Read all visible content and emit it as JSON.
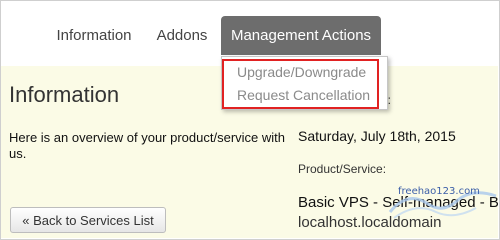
{
  "tabs": [
    {
      "label": "Information"
    },
    {
      "label": "Addons"
    },
    {
      "label": "Management Actions",
      "active": true
    }
  ],
  "dropdown": {
    "items": [
      {
        "label": "Upgrade/Downgrade"
      },
      {
        "label": "Request Cancellation"
      }
    ]
  },
  "main": {
    "title": "Information",
    "overview": "Here is an overview of your product/service with us.",
    "label_cut": "e:",
    "registration_date": "Saturday, July 18th, 2015",
    "product_label": "Product/Service:",
    "product_value": "Basic VPS - Self-managed - Bar",
    "hostname": "localhost.localdomain"
  },
  "back_button": {
    "label": "« Back to Services List"
  },
  "watermark": {
    "text": "freehao123.com"
  },
  "colors": {
    "active_tab": "#6d6d6d",
    "content_bg": "#fbfbe6",
    "highlight": "#e12222"
  }
}
